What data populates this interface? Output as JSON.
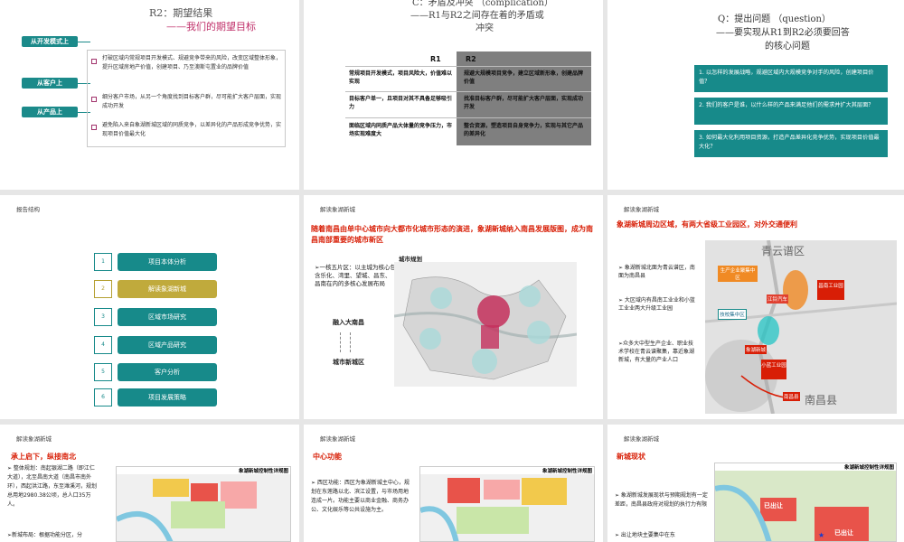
{
  "slide1": {
    "title1": "R2：期望结果",
    "title2": "——我们的期望目标",
    "tags": [
      "从开发模式上",
      "从客户上",
      "从产品上"
    ],
    "items": [
      "打破区域内常规项目开发模式、规避竞争带来的风险，改变区域整体形象，提升区域房地产价值，创建项目、乃至澳斯屯置业的品牌价值",
      "细分客户市场，从另一个角度找到目标客户群，尽可能扩大客户层面，实现成功开发",
      "避免陷入来自象湖新城区域的同质竞争，以差异化的产品形成竞争优势，实现项目价值最大化"
    ]
  },
  "slide2": {
    "title1": "C：矛盾及冲突 （complication）",
    "title2": "——R1与R2之间存在着的矛盾或",
    "title3": "冲突",
    "head_r1": "R1",
    "head_r2": "R2",
    "r1": [
      "常规项目开发模式，项目风险大，价值难以实现",
      "目标客户单一，且项目对其不具备足够吸引力",
      "面临区域内同质产品大体量的竞争压力，市场实现难度大"
    ],
    "r2": [
      "规避大规模项目竞争，建立区域新形象，创建品牌价值",
      "找准目标客户群，尽可能扩大客户层面，实现成功开发",
      "整合资源，塑造项目自身竞争力，实现与其它产品的差异化"
    ]
  },
  "slide3": {
    "title1": "Q：提出问题 （question）",
    "title2": "——要实现从R1到R2必须要回答",
    "title3": "的核心问题",
    "questions": [
      "1. 以怎样的发展战略，规避区域内大规模竞争对手的风险，创建项目价值？",
      "2. 我们的客户是谁，以什么样的产品来满足他们的需求并扩大其层面？",
      "3. 如何最大化利用项目资源，打造产品差异化竞争优势，实现项目价值最大化？"
    ]
  },
  "slide4": {
    "header": "报告结构",
    "outline": [
      {
        "num": "1",
        "label": "项目本体分析"
      },
      {
        "num": "2",
        "label": "解读象湖新城"
      },
      {
        "num": "3",
        "label": "区域市场研究"
      },
      {
        "num": "4",
        "label": "区域产品研究"
      },
      {
        "num": "5",
        "label": "客户分析"
      },
      {
        "num": "6",
        "label": "项目发展策略"
      }
    ]
  },
  "slide5": {
    "header": "解读象湖新城",
    "headline": "随着南昌由单中心城市向大都市化城市形态的演进，象湖新城纳入南昌发展版图，成为南昌南部重要的城市新区",
    "bullet": "➢一核五片区：以主城为核心包含乐化、湾里、望城、昌东、昌南在内的多核心发展布局",
    "map_label": "城市规划",
    "label_a": "融入大南昌",
    "label_b": "城市新城区"
  },
  "slide6": {
    "header": "解读象湖新城",
    "headline": "象湖新城周边区域，有两大省级工业园区，对外交通便利",
    "bullets": [
      "➢ 象湖新城北面为青云谱区，南面为南昌县",
      "➢ 大区域内有昌南工业业和小蓝工业业两大升级工业园",
      "➢众多大中型生产企业、职业技术学校在青云谱聚集，靠近象湖新城，有大量的产业人口"
    ],
    "map_labels": {
      "district": "青云谱区",
      "industry": "生产企业聚集中区",
      "school": "技校集中区",
      "jiangling": "江铃汽车",
      "changnan": "昌南工业园",
      "xiaolan": "小蓝工业园",
      "xiangchu": "象湖新城",
      "county": "南昌县",
      "nanchangxian": "南昌县"
    }
  },
  "slide7": {
    "header": "解读象湖新城",
    "headline": "承上启下，纵接南北",
    "lines": [
      "➢ 整体规划：南起银湖二路（即江仁大道），北至昌南大道（南昌市南外环），西起洪江路，东至潍溪河，规划总用地2980.38公顷，总人口35万人。",
      "➢新城布局：根据功能分区，分"
    ],
    "map_title": "象湖新城控制性详规图"
  },
  "slide8": {
    "header": "解读象湖新城",
    "headline": "中心功能",
    "lines": [
      "➢ 西区功能：西区为象湖新城主中心，规划在东莲路以北、滨江设置，与市场用地连成一片。功能主要以商业金融、商务办公、文化娱乐等公共设施为主。"
    ],
    "map_title": "象湖新城控制性详规图"
  },
  "slide9": {
    "header": "解读象湖新城",
    "headline": "新城现状",
    "lines": [
      "➢ 象湖新城发展现状与预期规划有一定差距，南昌县政府对规划的执行力有限",
      "➢ 出让地块主要集中在东"
    ],
    "map_title": "象湖新城控制性详规图",
    "sold_label": "已出让",
    "sold_label2": "已出让"
  },
  "colors": {
    "teal": "#178a8a",
    "gold": "#c0aa3c",
    "red": "#d81e06",
    "gray": "#7f7f7f"
  }
}
